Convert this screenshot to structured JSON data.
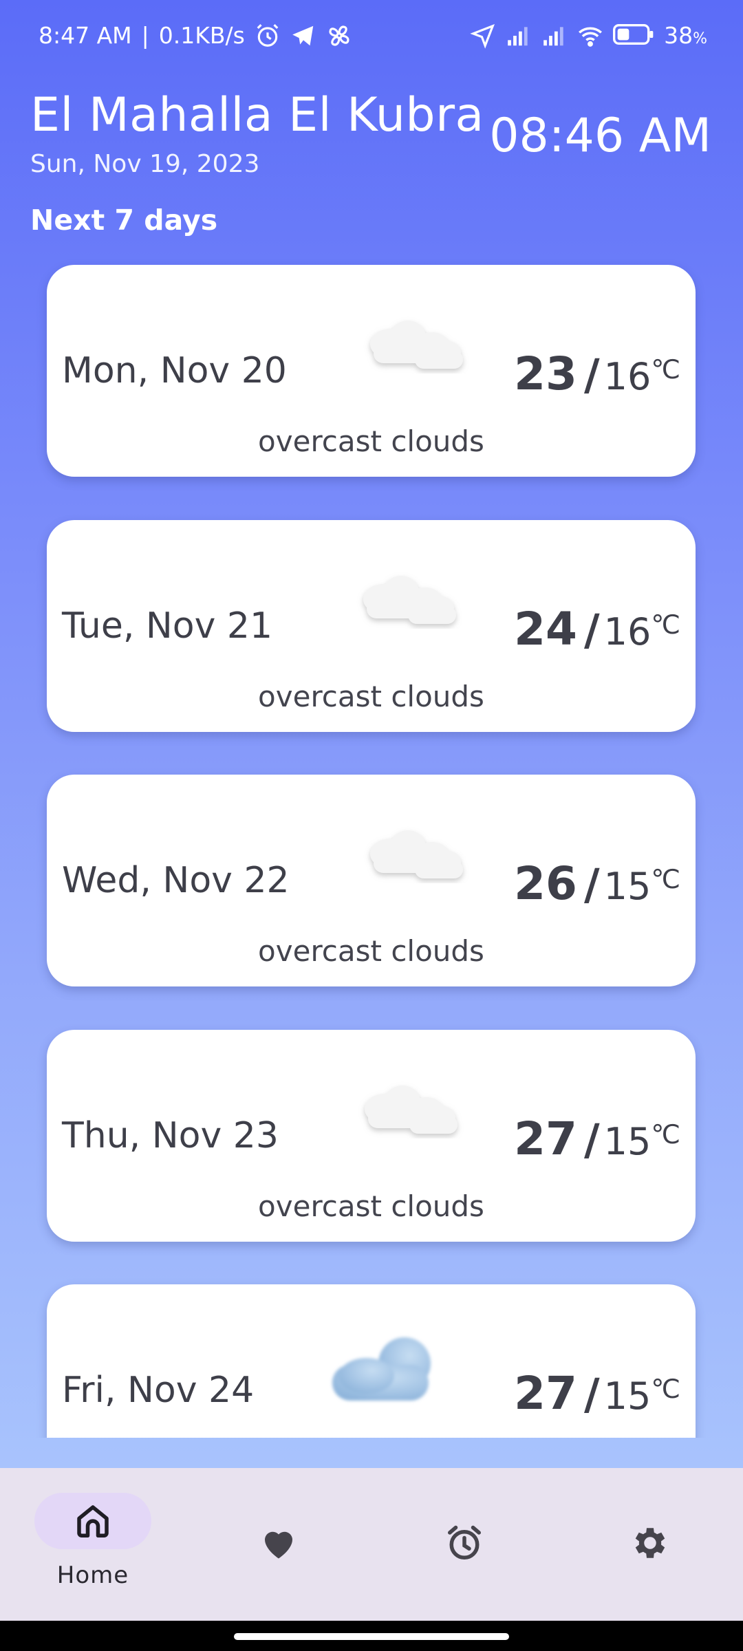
{
  "status_bar": {
    "time": "8:47 AM",
    "net_speed": "0.1KB/s",
    "battery": "38",
    "battery_unit": "%"
  },
  "header": {
    "city": "El Mahalla El Kubra",
    "date": "Sun, Nov 19, 2023",
    "clock": "08:46 AM"
  },
  "section_title": "Next 7 days",
  "forecast": [
    {
      "day": "Mon, Nov 20",
      "high": "23",
      "low": "16",
      "unit": "℃",
      "desc": "overcast clouds",
      "icon": "overcast-clouds-icon"
    },
    {
      "day": "Tue, Nov 21",
      "high": "24",
      "low": "16",
      "unit": "℃",
      "desc": "overcast clouds",
      "icon": "overcast-clouds-icon"
    },
    {
      "day": "Wed, Nov 22",
      "high": "26",
      "low": "15",
      "unit": "℃",
      "desc": "overcast clouds",
      "icon": "overcast-clouds-icon"
    },
    {
      "day": "Thu, Nov 23",
      "high": "27",
      "low": "15",
      "unit": "℃",
      "desc": "overcast clouds",
      "icon": "overcast-clouds-icon"
    },
    {
      "day": "Fri, Nov 24",
      "high": "27",
      "low": "15",
      "unit": "℃",
      "desc": "",
      "icon": "blue-cloud-icon"
    }
  ],
  "bottom_nav": {
    "home_label": "Home",
    "active": "home"
  },
  "colors": {
    "gradient_top": "#5b6cf8",
    "gradient_bottom": "#b0c9fe",
    "card_bg": "#ffffff",
    "text_dark": "#3e3f49",
    "nav_bg": "#e8e2ef",
    "nav_active_pill": "#e3d7f7"
  }
}
